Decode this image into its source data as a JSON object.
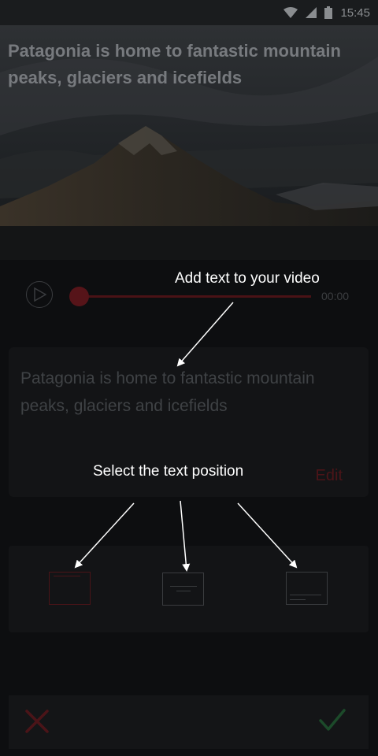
{
  "status_bar": {
    "time": "15:45",
    "icons": [
      "wifi-icon",
      "signal-icon",
      "battery-icon"
    ]
  },
  "video": {
    "overlay_caption": "Patagonia is home to fantastic mountain peaks, glaciers and icefields"
  },
  "player": {
    "play_icon": "play-icon",
    "time": "00:00",
    "progress": 0
  },
  "text_card": {
    "text": "Patagonia is home to fantastic mountain peaks, glaciers and icefields",
    "edit_label": "Edit"
  },
  "positions": {
    "options": [
      "top",
      "center",
      "bottom"
    ],
    "selected": "top"
  },
  "actions": {
    "cancel_icon": "close-icon",
    "confirm_icon": "check-icon"
  },
  "hints": {
    "add_text": "Add text to your video",
    "select_position": "Select the text position"
  },
  "colors": {
    "accent": "#561419",
    "confirm": "#1c4a2a",
    "background": "#0d0e10"
  }
}
